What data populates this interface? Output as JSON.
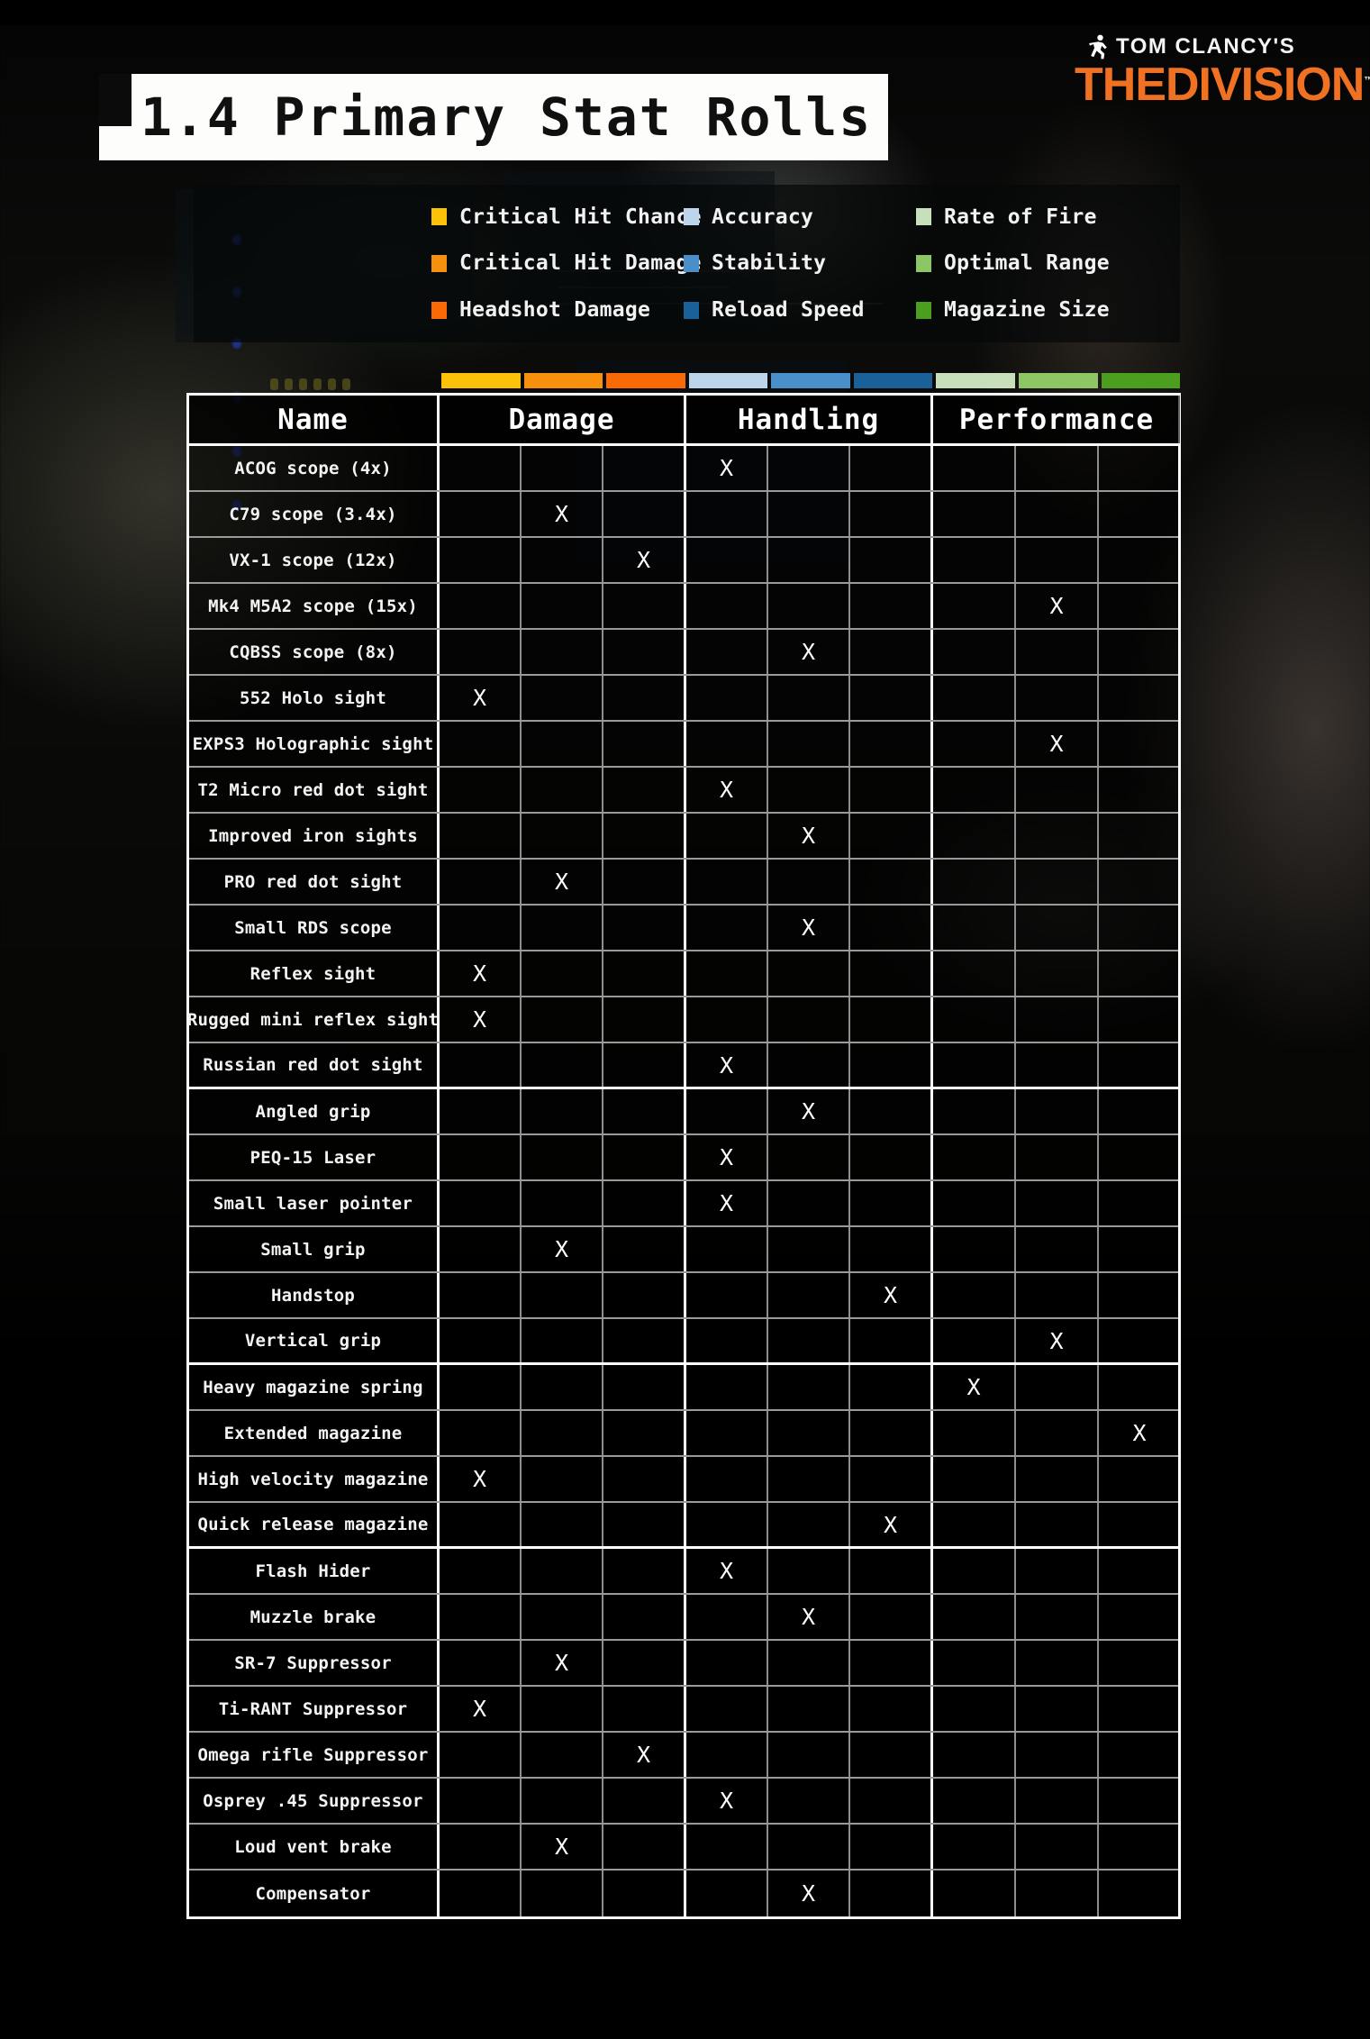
{
  "title": {
    "text": "1.4 Primary Stat Rolls"
  },
  "logo": {
    "top_line": "TOM CLANCY'S",
    "the": "THE",
    "division": "DIVISION",
    "tm": "™",
    "accent": "#f07122"
  },
  "legend": {
    "items": [
      {
        "label": "Critical Hit Chance",
        "color": "#fcc109"
      },
      {
        "label": "Accuracy",
        "color": "#bcd4ec"
      },
      {
        "label": "Rate of Fire",
        "color": "#c7dfba"
      },
      {
        "label": "Critical Hit Damage",
        "color": "#f6900d"
      },
      {
        "label": "Stability",
        "color": "#4b8fca"
      },
      {
        "label": "Optimal Range",
        "color": "#8dc765"
      },
      {
        "label": "Headshot Damage",
        "color": "#f96a07"
      },
      {
        "label": "Reload Speed",
        "color": "#1a6199"
      },
      {
        "label": "Magazine Size",
        "color": "#4c9e1e"
      }
    ]
  },
  "colorbar": [
    "#fcc109",
    "#f6900d",
    "#f96a07",
    "#bcd4ec",
    "#4b8fca",
    "#1a6199",
    "#c7dfba",
    "#8dc765",
    "#4c9e1e"
  ],
  "table": {
    "headers": [
      "Name",
      "Damage",
      "Handling",
      "Performance"
    ],
    "stat_columns": [
      "Critical Hit Chance",
      "Critical Hit Damage",
      "Headshot Damage",
      "Accuracy",
      "Stability",
      "Reload Speed",
      "Rate of Fire",
      "Optimal Range",
      "Magazine Size"
    ],
    "mark": "X",
    "rows": [
      {
        "name": "ACOG scope (4x)",
        "marks": [
          0,
          0,
          0,
          1,
          0,
          0,
          0,
          0,
          0
        ],
        "group_end": false
      },
      {
        "name": "C79 scope (3.4x)",
        "marks": [
          0,
          1,
          0,
          0,
          0,
          0,
          0,
          0,
          0
        ],
        "group_end": false
      },
      {
        "name": "VX-1 scope (12x)",
        "marks": [
          0,
          0,
          1,
          0,
          0,
          0,
          0,
          0,
          0
        ],
        "group_end": false
      },
      {
        "name": "Mk4 M5A2 scope (15x)",
        "marks": [
          0,
          0,
          0,
          0,
          0,
          0,
          0,
          1,
          0
        ],
        "group_end": false
      },
      {
        "name": "CQBSS scope (8x)",
        "marks": [
          0,
          0,
          0,
          0,
          1,
          0,
          0,
          0,
          0
        ],
        "group_end": false
      },
      {
        "name": "552 Holo sight",
        "marks": [
          1,
          0,
          0,
          0,
          0,
          0,
          0,
          0,
          0
        ],
        "group_end": false
      },
      {
        "name": "EXPS3 Holographic sight",
        "marks": [
          0,
          0,
          0,
          0,
          0,
          0,
          0,
          1,
          0
        ],
        "group_end": false
      },
      {
        "name": "T2 Micro red dot sight",
        "marks": [
          0,
          0,
          0,
          1,
          0,
          0,
          0,
          0,
          0
        ],
        "group_end": false
      },
      {
        "name": "Improved iron sights",
        "marks": [
          0,
          0,
          0,
          0,
          1,
          0,
          0,
          0,
          0
        ],
        "group_end": false
      },
      {
        "name": "PRO red dot sight",
        "marks": [
          0,
          1,
          0,
          0,
          0,
          0,
          0,
          0,
          0
        ],
        "group_end": false
      },
      {
        "name": "Small RDS scope",
        "marks": [
          0,
          0,
          0,
          0,
          1,
          0,
          0,
          0,
          0
        ],
        "group_end": false
      },
      {
        "name": "Reflex sight",
        "marks": [
          1,
          0,
          0,
          0,
          0,
          0,
          0,
          0,
          0
        ],
        "group_end": false
      },
      {
        "name": "Rugged mini reflex sight",
        "marks": [
          1,
          0,
          0,
          0,
          0,
          0,
          0,
          0,
          0
        ],
        "group_end": false
      },
      {
        "name": "Russian red dot sight",
        "marks": [
          0,
          0,
          0,
          1,
          0,
          0,
          0,
          0,
          0
        ],
        "group_end": true
      },
      {
        "name": "Angled grip",
        "marks": [
          0,
          0,
          0,
          0,
          1,
          0,
          0,
          0,
          0
        ],
        "group_end": false
      },
      {
        "name": "PEQ-15 Laser",
        "marks": [
          0,
          0,
          0,
          1,
          0,
          0,
          0,
          0,
          0
        ],
        "group_end": false
      },
      {
        "name": "Small laser pointer",
        "marks": [
          0,
          0,
          0,
          1,
          0,
          0,
          0,
          0,
          0
        ],
        "group_end": false
      },
      {
        "name": "Small grip",
        "marks": [
          0,
          1,
          0,
          0,
          0,
          0,
          0,
          0,
          0
        ],
        "group_end": false
      },
      {
        "name": "Handstop",
        "marks": [
          0,
          0,
          0,
          0,
          0,
          1,
          0,
          0,
          0
        ],
        "group_end": false
      },
      {
        "name": "Vertical grip",
        "marks": [
          0,
          0,
          0,
          0,
          0,
          0,
          0,
          1,
          0
        ],
        "group_end": true
      },
      {
        "name": "Heavy magazine spring",
        "marks": [
          0,
          0,
          0,
          0,
          0,
          0,
          1,
          0,
          0
        ],
        "group_end": false
      },
      {
        "name": "Extended magazine",
        "marks": [
          0,
          0,
          0,
          0,
          0,
          0,
          0,
          0,
          1
        ],
        "group_end": false
      },
      {
        "name": "High velocity magazine",
        "marks": [
          1,
          0,
          0,
          0,
          0,
          0,
          0,
          0,
          0
        ],
        "group_end": false
      },
      {
        "name": "Quick release magazine",
        "marks": [
          0,
          0,
          0,
          0,
          0,
          1,
          0,
          0,
          0
        ],
        "group_end": true
      },
      {
        "name": "Flash Hider",
        "marks": [
          0,
          0,
          0,
          1,
          0,
          0,
          0,
          0,
          0
        ],
        "group_end": false
      },
      {
        "name": "Muzzle brake",
        "marks": [
          0,
          0,
          0,
          0,
          1,
          0,
          0,
          0,
          0
        ],
        "group_end": false
      },
      {
        "name": "SR-7 Suppressor",
        "marks": [
          0,
          1,
          0,
          0,
          0,
          0,
          0,
          0,
          0
        ],
        "group_end": false
      },
      {
        "name": "Ti-RANT Suppressor",
        "marks": [
          1,
          0,
          0,
          0,
          0,
          0,
          0,
          0,
          0
        ],
        "group_end": false
      },
      {
        "name": "Omega rifle Suppressor",
        "marks": [
          0,
          0,
          1,
          0,
          0,
          0,
          0,
          0,
          0
        ],
        "group_end": false
      },
      {
        "name": "Osprey .45 Suppressor",
        "marks": [
          0,
          0,
          0,
          1,
          0,
          0,
          0,
          0,
          0
        ],
        "group_end": false
      },
      {
        "name": "Loud vent brake",
        "marks": [
          0,
          1,
          0,
          0,
          0,
          0,
          0,
          0,
          0
        ],
        "group_end": false
      },
      {
        "name": "Compensator",
        "marks": [
          0,
          0,
          0,
          0,
          1,
          0,
          0,
          0,
          0
        ],
        "group_end": false
      }
    ]
  }
}
